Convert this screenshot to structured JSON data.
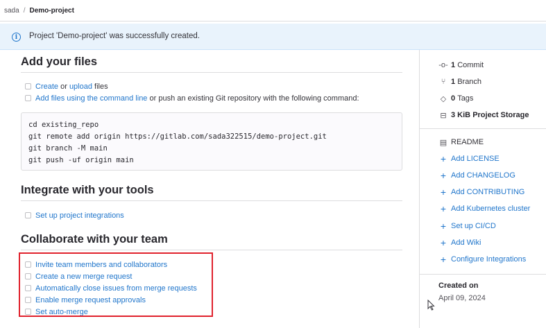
{
  "breadcrumb": {
    "parent": "sada",
    "separator": "/",
    "current": "Demo-project"
  },
  "alert": {
    "message": "Project 'Demo-project' was successfully created."
  },
  "add_files": {
    "title": "Add your files",
    "row1": {
      "link1": "Create",
      "or": " or ",
      "link2": "upload",
      "after": " files"
    },
    "row2": {
      "link": "Add files using the command line",
      "after": " or push an existing Git repository with the following command:"
    },
    "code": [
      "cd existing_repo",
      "git remote add origin https://gitlab.com/sada322515/demo-project.git",
      "git branch -M main",
      "git push -uf origin main"
    ]
  },
  "integrate": {
    "title": "Integrate with your tools",
    "item": "Set up project integrations"
  },
  "collaborate": {
    "title": "Collaborate with your team",
    "items": [
      "Invite team members and collaborators",
      "Create a new merge request",
      "Automatically close issues from merge requests",
      "Enable merge request approvals",
      "Set auto-merge"
    ]
  },
  "sidebar": {
    "stats": [
      {
        "icon": "commit-icon",
        "value": "1",
        "label": "Commit"
      },
      {
        "icon": "branch-icon",
        "value": "1",
        "label": "Branch"
      },
      {
        "icon": "tag-icon",
        "value": "0",
        "label": "Tags"
      },
      {
        "icon": "storage-icon",
        "value": "3 KiB",
        "label": "Project Storage"
      }
    ],
    "readme": "README",
    "actions": [
      "Add LICENSE",
      "Add CHANGELOG",
      "Add CONTRIBUTING",
      "Add Kubernetes cluster",
      "Set up CI/CD",
      "Add Wiki",
      "Configure Integrations"
    ],
    "created_label": "Created on",
    "created_date": "April 09, 2024"
  },
  "colors": {
    "link": "#1f75cb",
    "alert_bg": "#e9f3fc",
    "highlight": "#e0212c"
  }
}
